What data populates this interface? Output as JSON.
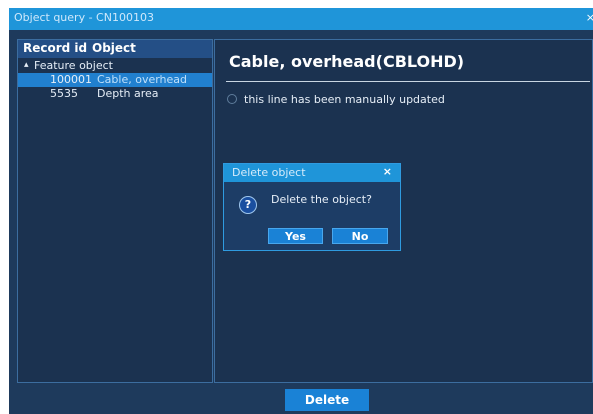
{
  "window": {
    "title": "Object query - CN100103",
    "close_glyph": "×"
  },
  "tree": {
    "columns": [
      "Record id",
      "Object"
    ],
    "group": {
      "expand_glyph": "▴",
      "label": "Feature object"
    },
    "rows": [
      {
        "id": "100001",
        "object": "Cable, overhead",
        "selected": true
      },
      {
        "id": "5535",
        "object": "Depth area",
        "selected": false
      }
    ]
  },
  "detail": {
    "title": "Cable, overhead(CBLOHD)",
    "attribute_text": "this line has been manually updated"
  },
  "dialog": {
    "title": "Delete object",
    "close_glyph": "×",
    "icon": "question-icon",
    "icon_glyph": "?",
    "message": "Delete the object?",
    "yes_label": "Yes",
    "no_label": "No"
  },
  "footer": {
    "delete_label": "Delete"
  },
  "colors": {
    "window_bg": "#1e3a5c",
    "titlebar": "#1f95d9",
    "selection": "#2180cf",
    "button": "#1a82d6"
  }
}
